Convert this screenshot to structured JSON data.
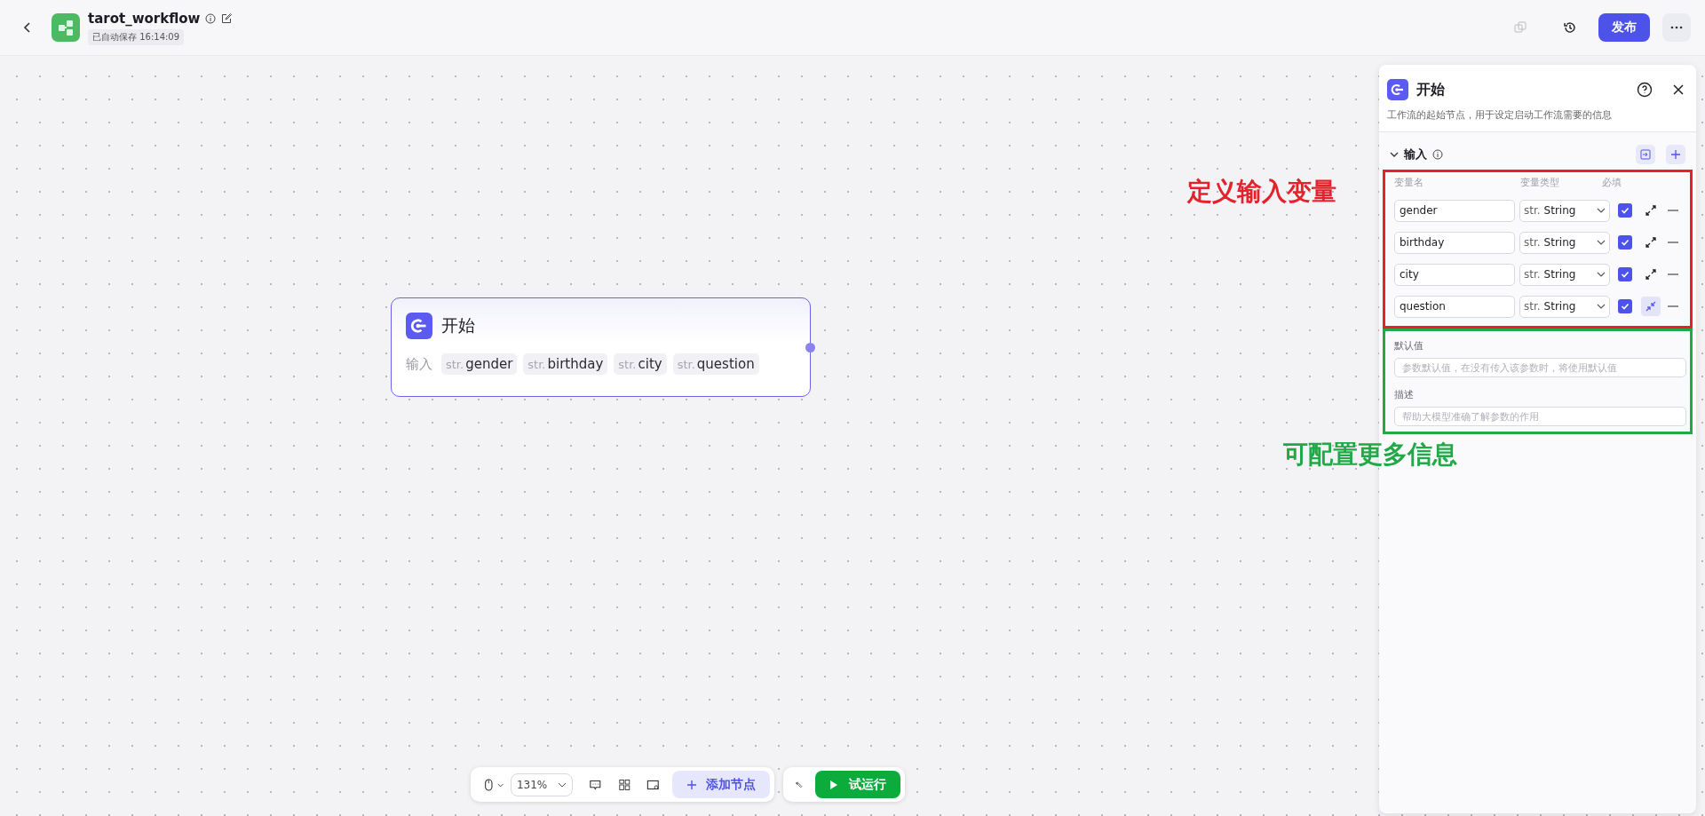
{
  "header": {
    "title": "tarot_workflow",
    "autosave": "已自动保存 16:14:09",
    "publish_button": "发布"
  },
  "node": {
    "title": "开始",
    "input_label": "输入",
    "params": [
      {
        "type": "str.",
        "name": "gender"
      },
      {
        "type": "str.",
        "name": "birthday"
      },
      {
        "type": "str.",
        "name": "city"
      },
      {
        "type": "str.",
        "name": "question"
      }
    ]
  },
  "panel": {
    "title": "开始",
    "description": "工作流的起始节点，用于设定启动工作流需要的信息",
    "section_title": "输入",
    "columns": [
      "变量名",
      "变量类型",
      "必填"
    ],
    "variables": [
      {
        "name": "gender",
        "type_prefix": "str.",
        "type": "String",
        "required": true,
        "expanded": false
      },
      {
        "name": "birthday",
        "type_prefix": "str.",
        "type": "String",
        "required": true,
        "expanded": false
      },
      {
        "name": "city",
        "type_prefix": "str.",
        "type": "String",
        "required": true,
        "expanded": false
      },
      {
        "name": "question",
        "type_prefix": "str.",
        "type": "String",
        "required": true,
        "expanded": true
      }
    ],
    "default_label": "默认值",
    "default_placeholder": "参数默认值，在没有传入该参数时，将使用默认值",
    "description_label": "描述",
    "description_placeholder": "帮助大模型准确了解参数的作用"
  },
  "annotations": [
    {
      "text": "定义输入变量",
      "color": "#e3222b"
    },
    {
      "text": "可配置更多信息",
      "color": "#22a846"
    }
  ],
  "toolbar": {
    "zoom": "131%",
    "add_node_button": "添加节点",
    "run_button": "试运行"
  }
}
